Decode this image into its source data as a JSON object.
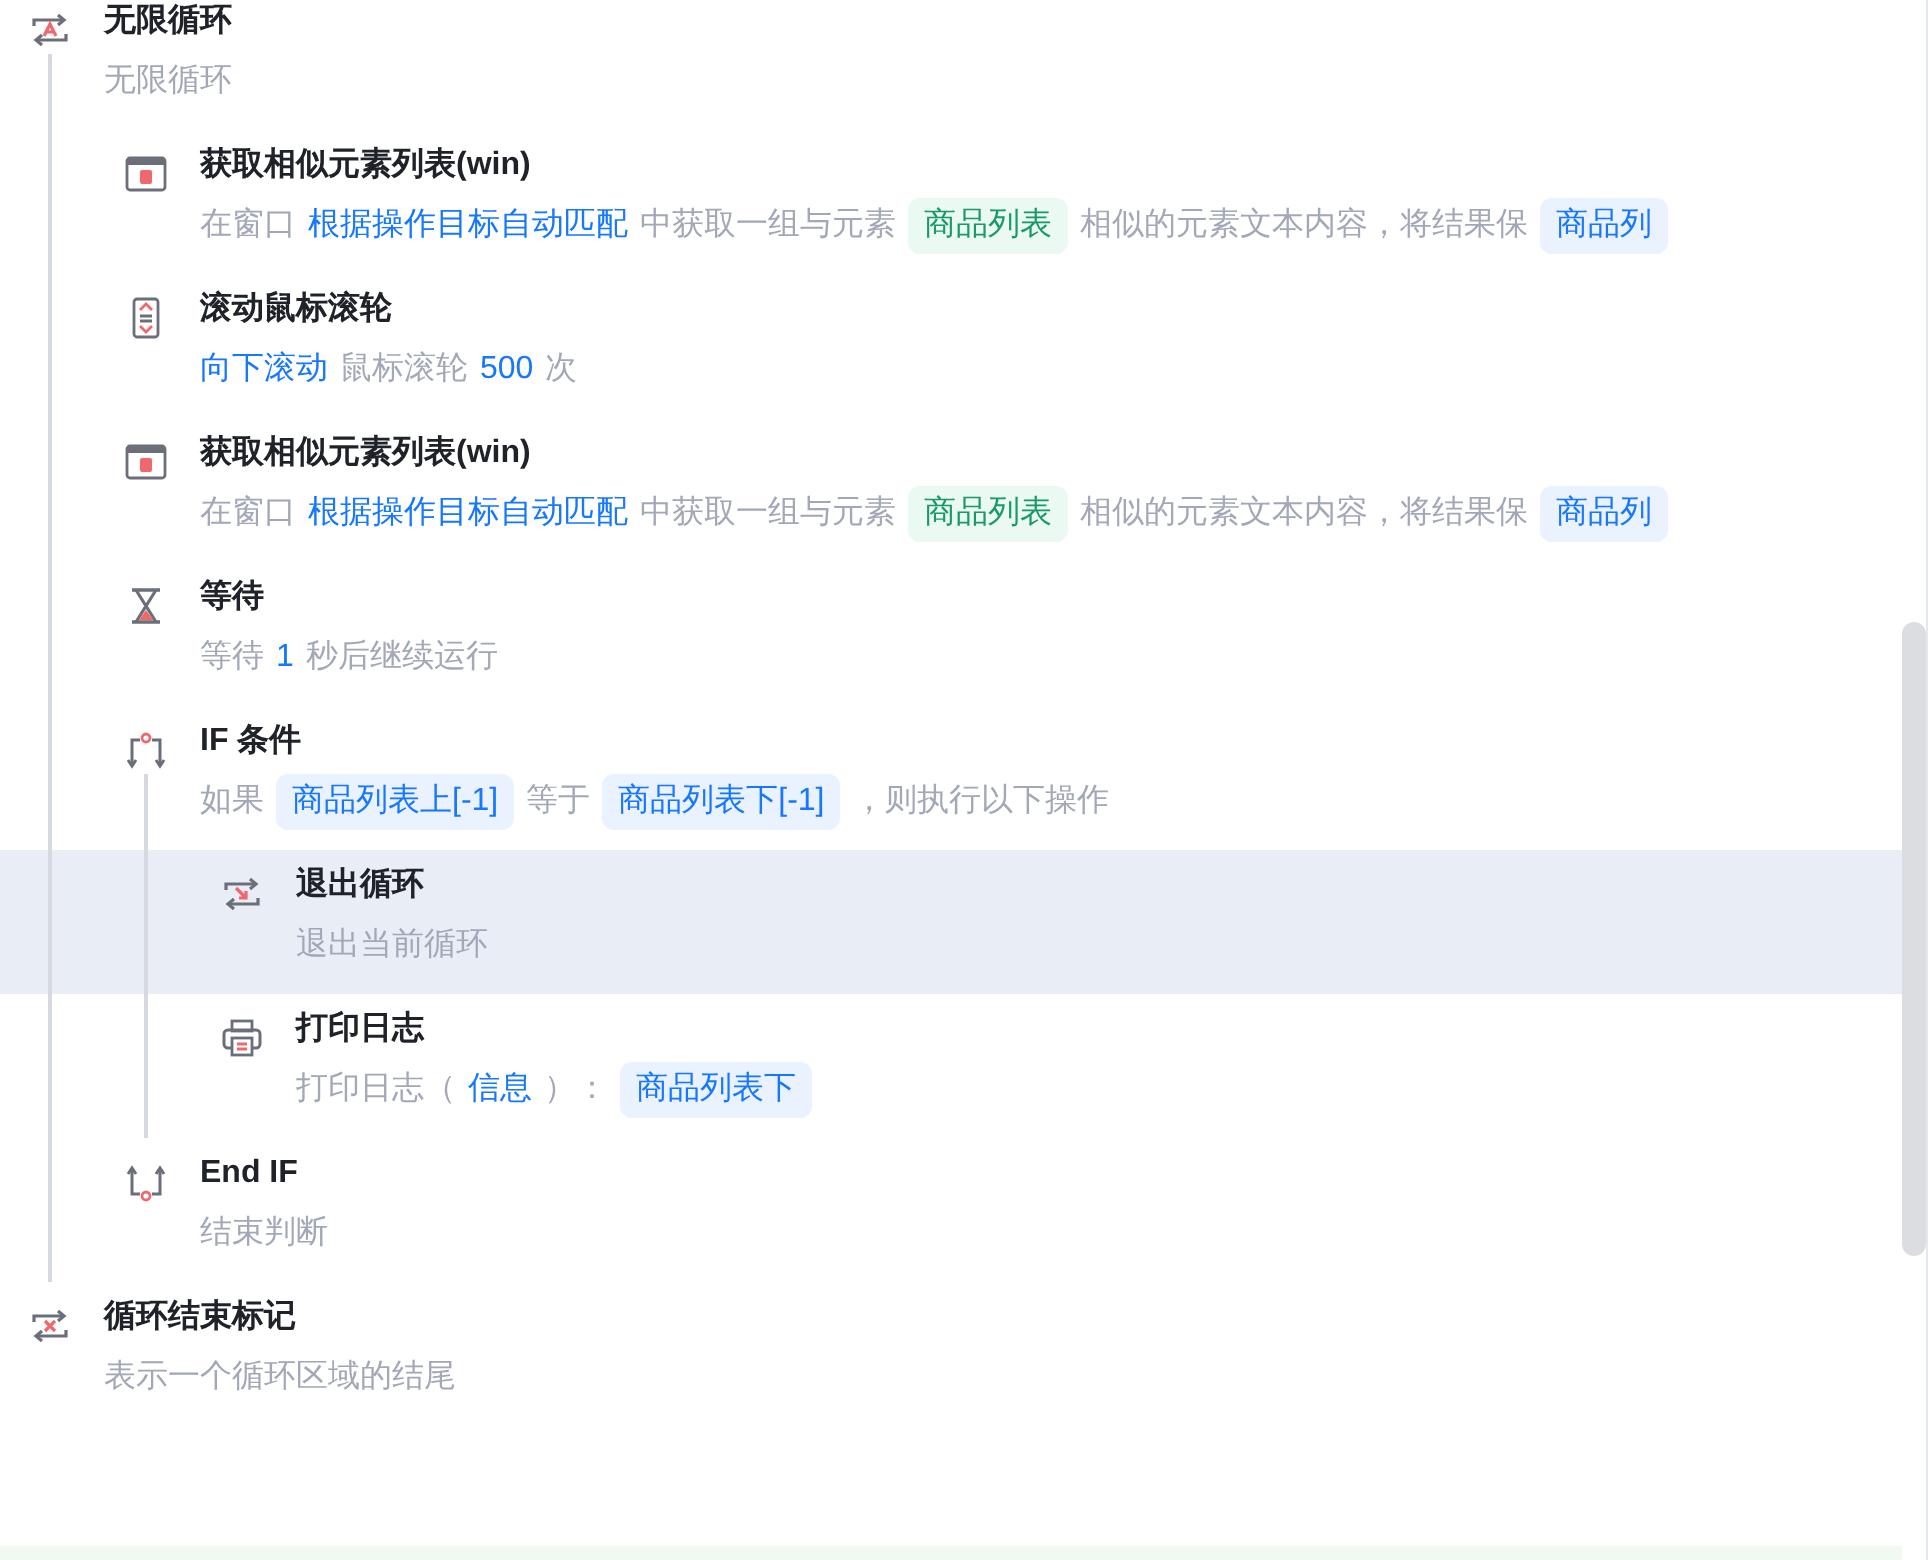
{
  "steps": [
    {
      "kind": "loop",
      "title": "无限循环",
      "selected": false,
      "description": [
        {
          "kind": "text",
          "text": "无限循环"
        }
      ],
      "children": [
        {
          "kind": "element-list",
          "title": "获取相似元素列表(win)",
          "selected": false,
          "description": [
            {
              "kind": "text",
              "text": "在窗口"
            },
            {
              "kind": "link",
              "text": "根据操作目标自动匹配"
            },
            {
              "kind": "text",
              "text": "中获取一组与元素"
            },
            {
              "kind": "green-tag",
              "text": "商品列表"
            },
            {
              "kind": "text",
              "text": "相似的元素文本内容，将结果保"
            },
            {
              "kind": "tag",
              "text": "商品列"
            }
          ]
        },
        {
          "kind": "scroll",
          "title": "滚动鼠标滚轮",
          "selected": false,
          "description": [
            {
              "kind": "link",
              "text": "向下滚动"
            },
            {
              "kind": "text",
              "text": "鼠标滚轮"
            },
            {
              "kind": "link",
              "text": "500"
            },
            {
              "kind": "text",
              "text": "次"
            }
          ]
        },
        {
          "kind": "element-list",
          "title": "获取相似元素列表(win)",
          "selected": false,
          "description": [
            {
              "kind": "text",
              "text": "在窗口"
            },
            {
              "kind": "link",
              "text": "根据操作目标自动匹配"
            },
            {
              "kind": "text",
              "text": "中获取一组与元素"
            },
            {
              "kind": "green-tag",
              "text": "商品列表"
            },
            {
              "kind": "text",
              "text": "相似的元素文本内容，将结果保"
            },
            {
              "kind": "tag",
              "text": "商品列"
            }
          ]
        },
        {
          "kind": "wait",
          "title": "等待",
          "selected": false,
          "description": [
            {
              "kind": "text",
              "text": "等待"
            },
            {
              "kind": "link",
              "text": "1"
            },
            {
              "kind": "text",
              "text": "秒后继续运行"
            }
          ]
        },
        {
          "kind": "if",
          "title": "IF 条件",
          "selected": false,
          "description": [
            {
              "kind": "text",
              "text": "如果"
            },
            {
              "kind": "tag",
              "text": "商品列表上[-1]"
            },
            {
              "kind": "text",
              "text": "等于"
            },
            {
              "kind": "tag",
              "text": "商品列表下[-1]"
            },
            {
              "kind": "text",
              "text": "，则执行以下操作"
            }
          ],
          "children": [
            {
              "kind": "loop-exit",
              "title": "退出循环",
              "selected": true,
              "description": [
                {
                  "kind": "text",
                  "text": "退出当前循环"
                }
              ]
            },
            {
              "kind": "print",
              "title": "打印日志",
              "selected": false,
              "description": [
                {
                  "kind": "text",
                  "text": "打印日志（"
                },
                {
                  "kind": "link",
                  "text": "信息"
                },
                {
                  "kind": "text",
                  "text": "）："
                },
                {
                  "kind": "tag",
                  "text": "商品列表下"
                }
              ]
            }
          ]
        },
        {
          "kind": "end-if",
          "title": "End IF",
          "selected": false,
          "description": [
            {
              "kind": "text",
              "text": "结束判断"
            }
          ]
        }
      ]
    },
    {
      "kind": "loop-end",
      "title": "循环结束标记",
      "selected": false,
      "description": [
        {
          "kind": "text",
          "text": "表示一个循环区域的结尾"
        }
      ]
    }
  ]
}
